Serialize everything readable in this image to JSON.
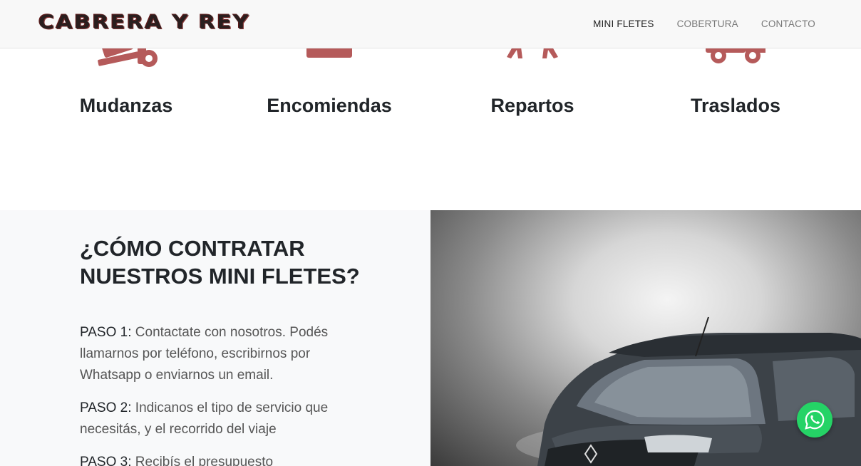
{
  "brand": {
    "name": "CABRERA Y REY"
  },
  "nav": {
    "items": [
      {
        "label": "MINI FLETES",
        "active": true
      },
      {
        "label": "COBERTURA",
        "active": false
      },
      {
        "label": "CONTACTO",
        "active": false
      }
    ]
  },
  "services": [
    {
      "label": "Mudanzas",
      "icon": "dolly-icon"
    },
    {
      "label": "Encomiendas",
      "icon": "box-icon"
    },
    {
      "label": "Repartos",
      "icon": "people-carry-icon"
    },
    {
      "label": "Traslados",
      "icon": "truck-icon"
    }
  ],
  "howto": {
    "title_line1": "¿CÓMO CONTRATAR",
    "title_line2": "NUESTROS MINI FLETES?",
    "steps": [
      {
        "label": "PASO 1:",
        "text": "Contactate con nosotros. Podés llamarnos por teléfono, escribirnos por Whatsapp o enviarnos un email."
      },
      {
        "label": "PASO 2:",
        "text": "Indicanos el tipo de servicio que necesitás, y el recorrido del viaje"
      },
      {
        "label": "PASO 3:",
        "text": "Recibís el presupuesto"
      }
    ]
  },
  "colors": {
    "accent": "#b55a5a",
    "whatsapp": "#25d366"
  },
  "whatsapp": {
    "icon": "whatsapp-icon"
  }
}
